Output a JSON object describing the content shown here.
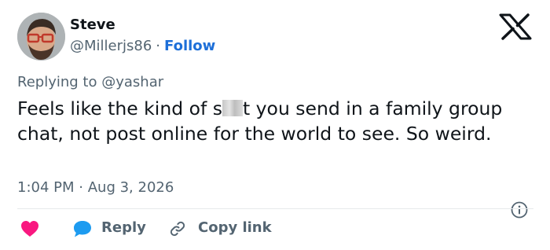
{
  "author": {
    "name": "Steve",
    "handle": "@Millerjs86",
    "separator": "·",
    "follow_label": "Follow"
  },
  "reply_context": {
    "prefix": "Replying to",
    "mention": "@yashar"
  },
  "tweet": {
    "text_part1": "Feels like the kind of s",
    "text_part2": "t you send in a family group chat, not post online for the world to see. So weird."
  },
  "timestamp": {
    "time": "1:04 PM",
    "separator": "·",
    "date": "Aug 3, 2026"
  },
  "actions": {
    "reply_label": "Reply",
    "copy_link_label": "Copy link"
  },
  "colors": {
    "heart": "#f91880",
    "reply_bubble": "#1d9bf0",
    "follow": "#1d6fd8",
    "secondary_text": "#536471"
  },
  "icons": [
    "x-logo-icon",
    "info-icon",
    "heart-icon",
    "reply-bubble-icon",
    "link-icon"
  ]
}
